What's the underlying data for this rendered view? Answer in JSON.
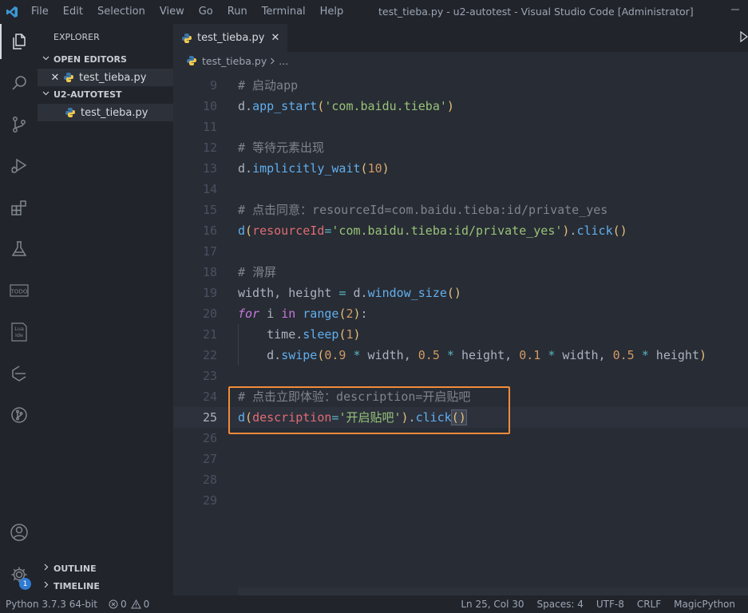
{
  "window": {
    "title": "test_tieba.py - u2-autotest - Visual Studio Code [Administrator]",
    "menu": [
      "File",
      "Edit",
      "Selection",
      "View",
      "Go",
      "Run",
      "Terminal",
      "Help"
    ]
  },
  "activity_bar": {
    "icons": [
      "explorer-icon",
      "search-icon",
      "source-control-icon",
      "run-debug-icon",
      "extensions-icon",
      "testing-icon",
      "todo-icon",
      "lua-ide-icon",
      "gitlens-icon",
      "remote-icon",
      "account-icon",
      "manage-gear-icon"
    ],
    "todo_label": "TODO",
    "lua_label_1": "Lua",
    "lua_label_2": "Ide",
    "settings_badge": "1"
  },
  "sidebar": {
    "title": "EXPLORER",
    "open_editors_label": "OPEN EDITORS",
    "open_editors": [
      {
        "name": "test_tieba.py"
      }
    ],
    "project_label": "U2-AUTOTEST",
    "files": [
      {
        "name": "test_tieba.py"
      }
    ],
    "outline_label": "OUTLINE",
    "timeline_label": "TIMELINE"
  },
  "editor": {
    "tab": {
      "label": "test_tieba.py"
    },
    "breadcrumb": {
      "file": "test_tieba.py",
      "more": "..."
    },
    "lines": [
      {
        "n": "9",
        "html": "<span class='cmt'># 启动app</span>"
      },
      {
        "n": "10",
        "html": "<span class='id'>d</span><span class='id'>.</span><span class='fn'>app_start</span><span class='paren'>(</span><span class='str'>'com.baidu.tieba'</span><span class='paren'>)</span>"
      },
      {
        "n": "11",
        "html": ""
      },
      {
        "n": "12",
        "html": "<span class='cmt'># 等待元素出现</span>"
      },
      {
        "n": "13",
        "html": "<span class='id'>d</span><span class='id'>.</span><span class='fn'>implicitly_wait</span><span class='paren'>(</span><span class='num'>10</span><span class='paren'>)</span>"
      },
      {
        "n": "14",
        "html": ""
      },
      {
        "n": "15",
        "html": "<span class='cmt'># 点击同意：resourceId=com.baidu.tieba:id/private_yes</span>"
      },
      {
        "n": "16",
        "html": "<span class='fn'>d</span><span class='paren'>(</span><span class='pm'>resourceId</span><span class='op'>=</span><span class='str'>'com.baidu.tieba:id/private_yes'</span><span class='paren'>)</span><span class='id'>.</span><span class='fn'>click</span><span class='paren'>()</span>"
      },
      {
        "n": "17",
        "html": ""
      },
      {
        "n": "18",
        "html": "<span class='cmt'># 滑屏</span>"
      },
      {
        "n": "19",
        "html": "<span class='id'>width, height </span><span class='op'>=</span><span class='id'> d.</span><span class='fn'>window_size</span><span class='paren'>()</span>"
      },
      {
        "n": "20",
        "html": "<span class='kw'>for</span><span class='id'> i </span><span class='kw2'>in</span><span class='id'> </span><span class='fn'>range</span><span class='paren'>(</span><span class='num'>2</span><span class='paren'>)</span><span class='id'>:</span>"
      },
      {
        "n": "21",
        "html": "<span class='id'>    time.</span><span class='fn'>sleep</span><span class='paren'>(</span><span class='num'>1</span><span class='paren'>)</span>"
      },
      {
        "n": "22",
        "html": "<span class='id'>    d.</span><span class='fn'>swipe</span><span class='paren'>(</span><span class='num'>0.9</span><span class='id'> </span><span class='op'>*</span><span class='id'> width, </span><span class='num'>0.5</span><span class='id'> </span><span class='op'>*</span><span class='id'> height, </span><span class='num'>0.1</span><span class='id'> </span><span class='op'>*</span><span class='id'> width, </span><span class='num'>0.5</span><span class='id'> </span><span class='op'>*</span><span class='id'> height</span><span class='paren'>)</span>"
      },
      {
        "n": "23",
        "html": ""
      },
      {
        "n": "24",
        "html": "<span class='cmt'># 点击立即体验：description=开启贴吧</span>"
      },
      {
        "n": "25",
        "html": "<span class='fn'>d</span><span class='paren'>(</span><span class='pm'>description</span><span class='op'>=</span><span class='str'>'开启贴吧'</span><span class='paren'>)</span><span class='id'>.</span><span class='fn'>click</span><span class='paren bracket-match'>()</span>",
        "current": true
      },
      {
        "n": "26",
        "html": ""
      },
      {
        "n": "27",
        "html": ""
      },
      {
        "n": "28",
        "html": ""
      },
      {
        "n": "29",
        "html": ""
      }
    ]
  },
  "statusbar": {
    "python": "Python 3.7.3 64-bit",
    "errors": "0",
    "warnings": "0",
    "position": "Ln 25, Col 30",
    "spaces": "Spaces: 4",
    "encoding": "UTF-8",
    "eol": "CRLF",
    "language": "MagicPython"
  },
  "colors": {
    "accent_highlight": "#f08c3a",
    "vscode_blue": "#2f7bd4"
  }
}
